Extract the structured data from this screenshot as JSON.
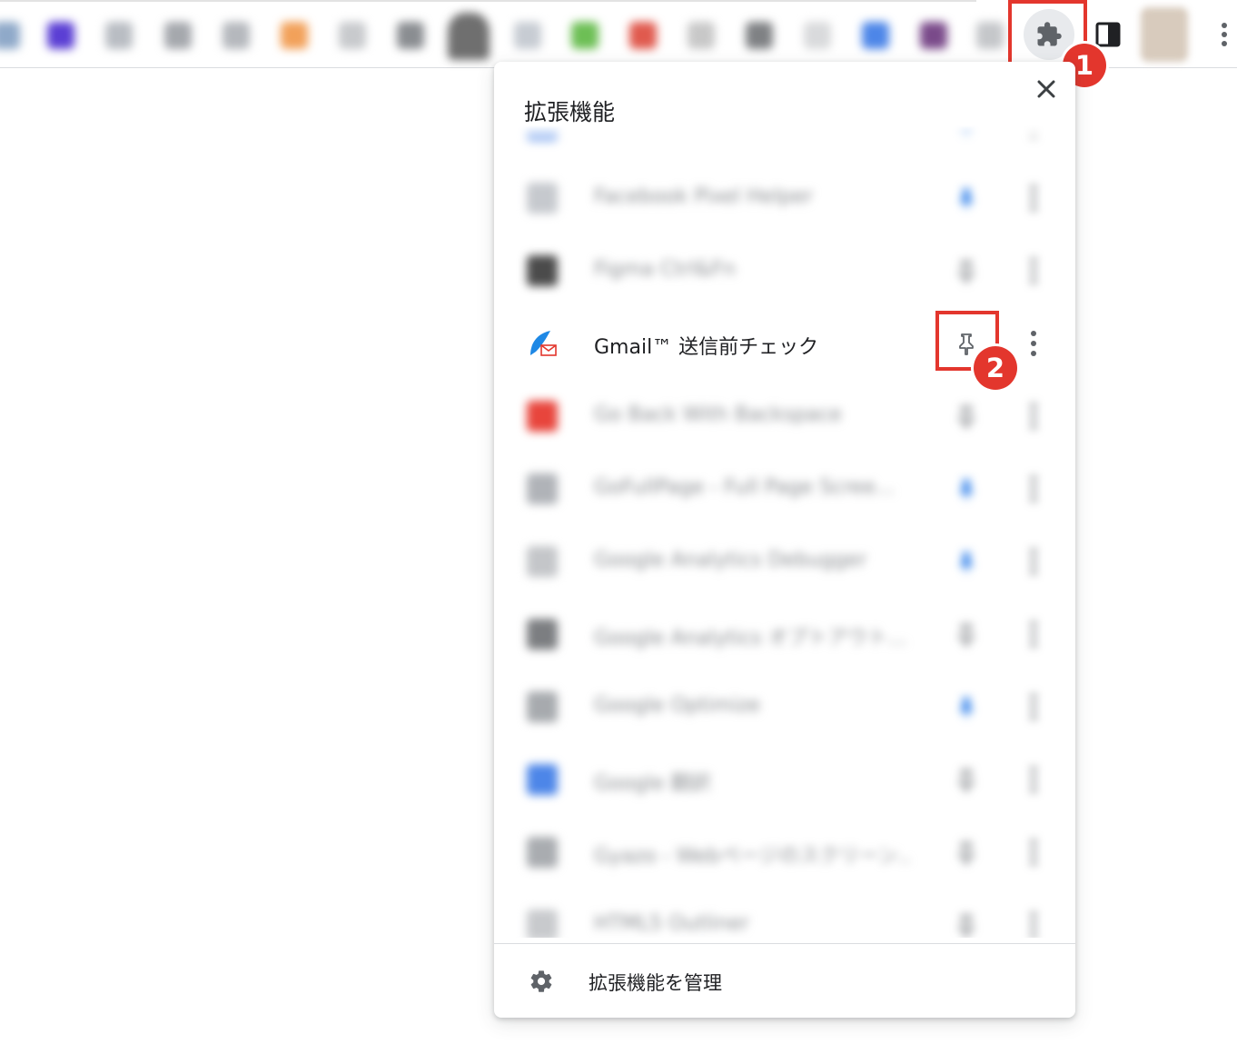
{
  "toolbar": {
    "extension_icons": [
      {
        "name": "blurred-extension-icon",
        "color": "#8fa9c9"
      },
      {
        "name": "blurred-extension-icon",
        "color": "#5b3fd4"
      },
      {
        "name": "blurred-extension-icon",
        "color": "#b9bdc3"
      },
      {
        "name": "blurred-extension-icon",
        "color": "#a5a8ad"
      },
      {
        "name": "blurred-extension-icon",
        "color": "#b5b8bd"
      },
      {
        "name": "blurred-extension-icon",
        "color": "#f2a15a"
      },
      {
        "name": "blurred-extension-icon",
        "color": "#c8cacd"
      },
      {
        "name": "blurred-extension-icon",
        "color": "#8a8d91"
      },
      {
        "name": "blurred-extension-icon",
        "color": "#6f6f6f"
      },
      {
        "name": "blurred-extension-icon",
        "color": "#c7ccd3"
      },
      {
        "name": "blurred-extension-icon",
        "color": "#6dbf55"
      },
      {
        "name": "blurred-extension-icon",
        "color": "#e05a4e"
      },
      {
        "name": "blurred-extension-icon",
        "color": "#c8c8c8"
      },
      {
        "name": "blurred-extension-icon",
        "color": "#7f8184"
      },
      {
        "name": "blurred-extension-icon",
        "color": "#d9dadc"
      },
      {
        "name": "blurred-extension-icon",
        "color": "#4d86e8"
      },
      {
        "name": "blurred-extension-icon",
        "color": "#7a4a8a"
      },
      {
        "name": "blurred-extension-icon",
        "color": "#c5c7ca"
      }
    ],
    "extensions_button_icon": "puzzle-icon",
    "side_panel_icon": "side-panel-icon",
    "menu_icon": "three-dots-icon"
  },
  "callouts": [
    {
      "number": "1",
      "color": "#e3362d"
    },
    {
      "number": "2",
      "color": "#e3362d"
    }
  ],
  "popup": {
    "title": "拡張機能",
    "close_icon": "close-icon",
    "extensions": [
      {
        "name": "",
        "pinned": true,
        "blurred": true,
        "icon_color": "#4d86e8"
      },
      {
        "name": "Facebook Pixel Helper",
        "pinned": true,
        "blurred": true,
        "icon_color": "#c6c9ce"
      },
      {
        "name": "Figma Ctrl&Fn",
        "pinned": false,
        "blurred": true,
        "icon_color": "#4b4b4b"
      },
      {
        "name": "Gmail™ 送信前チェック",
        "pinned": false,
        "blurred": false,
        "icon_color": "#1e88e5"
      },
      {
        "name": "Go Back With Backspace",
        "pinned": false,
        "blurred": true,
        "icon_color": "#e8453c"
      },
      {
        "name": "GoFullPage - Full Page Scree...",
        "pinned": true,
        "blurred": true,
        "icon_color": "#b0b3b8"
      },
      {
        "name": "Google Analytics Debugger",
        "pinned": true,
        "blurred": true,
        "icon_color": "#c4c6c9"
      },
      {
        "name": "Google Analytics オプトアウト...",
        "pinned": false,
        "blurred": true,
        "icon_color": "#7c7e81"
      },
      {
        "name": "Google Optimize",
        "pinned": true,
        "blurred": true,
        "icon_color": "#a7aaae"
      },
      {
        "name": "Google 翻訳",
        "pinned": false,
        "blurred": true,
        "icon_color": "#4d86e8"
      },
      {
        "name": "Gyazo - Webページのスクリーン...",
        "pinned": false,
        "blurred": true,
        "icon_color": "#a9acb0"
      },
      {
        "name": "HTML5 Outliner",
        "pinned": false,
        "blurred": true,
        "icon_color": "#c8cacd"
      }
    ],
    "pin_icon": "pin-icon",
    "more_icon": "more-vert-icon",
    "manage_label": "拡張機能を管理",
    "manage_icon": "gear-icon"
  }
}
